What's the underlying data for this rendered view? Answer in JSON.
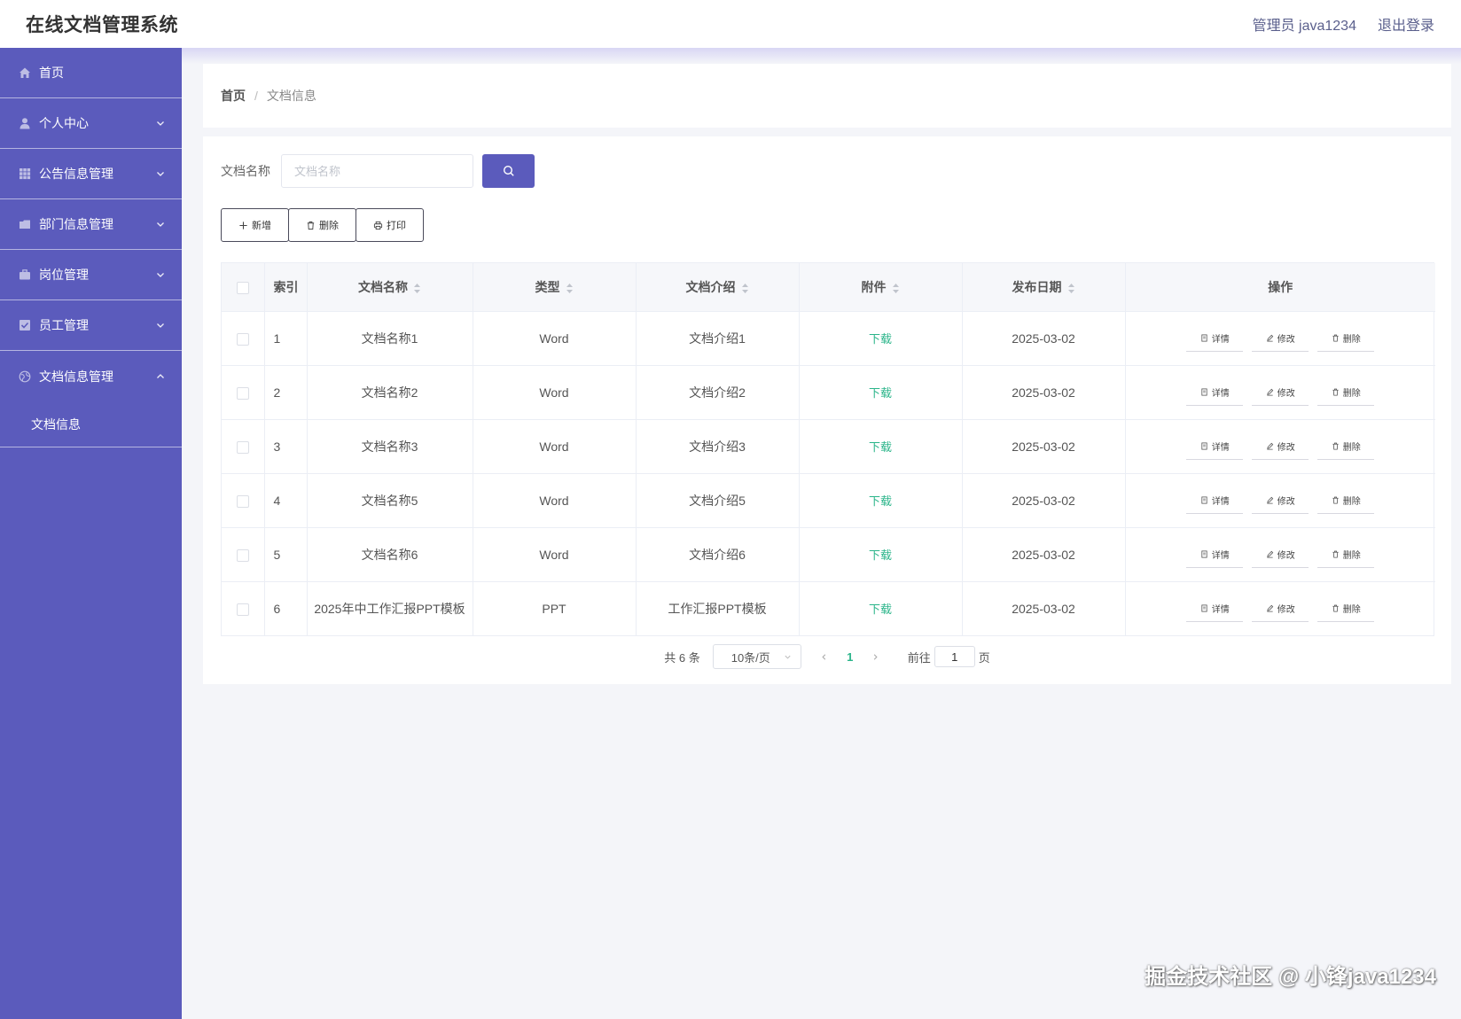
{
  "app": {
    "title": "在线文档管理系统"
  },
  "header": {
    "user": "管理员 java1234",
    "logout": "退出登录"
  },
  "sidebar": {
    "items": [
      {
        "label": "首页",
        "icon": "home-icon"
      },
      {
        "label": "个人中心",
        "icon": "user-icon"
      },
      {
        "label": "公告信息管理",
        "icon": "grid-icon"
      },
      {
        "label": "部门信息管理",
        "icon": "folder-icon"
      },
      {
        "label": "岗位管理",
        "icon": "briefcase-icon"
      },
      {
        "label": "员工管理",
        "icon": "check-square-icon"
      },
      {
        "label": "文档信息管理",
        "icon": "globe-icon"
      }
    ],
    "submenu": {
      "label": "文档信息"
    }
  },
  "breadcrumb": {
    "home": "首页",
    "sep": "/",
    "current": "文档信息"
  },
  "search": {
    "label": "文档名称",
    "placeholder": "文档名称",
    "value": ""
  },
  "actions": {
    "add": "新增",
    "delete": "删除",
    "print": "打印"
  },
  "table": {
    "headers": {
      "index": "索引",
      "name": "文档名称",
      "type": "类型",
      "intro": "文档介绍",
      "attachment": "附件",
      "date": "发布日期",
      "ops": "操作"
    },
    "rows": [
      {
        "index": "1",
        "name": "文档名称1",
        "type": "Word",
        "intro": "文档介绍1",
        "attachment": "下载",
        "date": "2025-03-02"
      },
      {
        "index": "2",
        "name": "文档名称2",
        "type": "Word",
        "intro": "文档介绍2",
        "attachment": "下载",
        "date": "2025-03-02"
      },
      {
        "index": "3",
        "name": "文档名称3",
        "type": "Word",
        "intro": "文档介绍3",
        "attachment": "下载",
        "date": "2025-03-02"
      },
      {
        "index": "4",
        "name": "文档名称5",
        "type": "Word",
        "intro": "文档介绍5",
        "attachment": "下载",
        "date": "2025-03-02"
      },
      {
        "index": "5",
        "name": "文档名称6",
        "type": "Word",
        "intro": "文档介绍6",
        "attachment": "下载",
        "date": "2025-03-02"
      },
      {
        "index": "6",
        "name": "2025年中工作汇报PPT模板",
        "type": "PPT",
        "intro": "工作汇报PPT模板",
        "attachment": "下载",
        "date": "2025-03-02"
      }
    ],
    "row_ops": {
      "detail": "详情",
      "edit": "修改",
      "delete": "删除"
    }
  },
  "pagination": {
    "total": "共 6 条",
    "page_size": "10条/页",
    "current_page": "1",
    "goto_label": "前往",
    "goto_value": "1",
    "page_suffix": "页"
  },
  "watermark": "掘金技术社区 @ 小锋java1234",
  "colors": {
    "sidebar": "#5b5bbc",
    "primary": "#5b5bbc",
    "link": "#2bb58a"
  }
}
